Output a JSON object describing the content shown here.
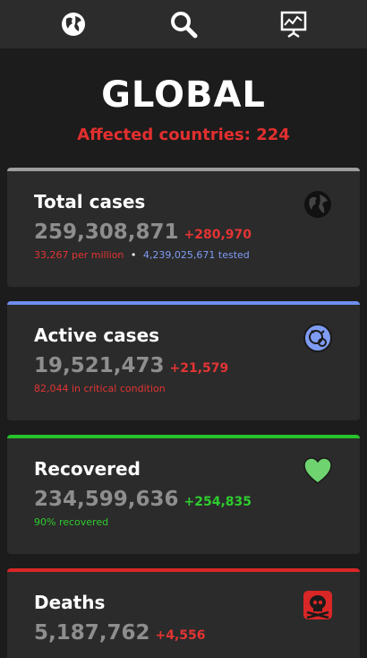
{
  "nav": {
    "items": [
      {
        "name": "globe-icon"
      },
      {
        "name": "search-icon"
      },
      {
        "name": "chart-presentation-icon"
      }
    ]
  },
  "header": {
    "title": "GLOBAL",
    "affected": "Affected countries: 224"
  },
  "cards": {
    "total": {
      "title": "Total cases",
      "value": "259,308,871",
      "delta": "+280,970",
      "per_million": "33,267 per million",
      "separator": "•",
      "tested": "4,239,025,671 tested",
      "icon": "globe-icon"
    },
    "active": {
      "title": "Active cases",
      "value": "19,521,473",
      "delta": "+21,579",
      "critical": "82,044 in critical condition",
      "icon": "virus-face-icon"
    },
    "recovered": {
      "title": "Recovered",
      "value": "234,599,636",
      "delta": "+254,835",
      "percent": "90% recovered",
      "icon": "heart-icon"
    },
    "deaths": {
      "title": "Deaths",
      "value": "5,187,762",
      "delta": "+4,556",
      "icon": "skull-icon"
    }
  },
  "colors": {
    "red": "#e33434",
    "green": "#2ecc2e",
    "blue": "#7f9cf5",
    "background": "#1c1c1c",
    "card": "#2b2b2b"
  }
}
